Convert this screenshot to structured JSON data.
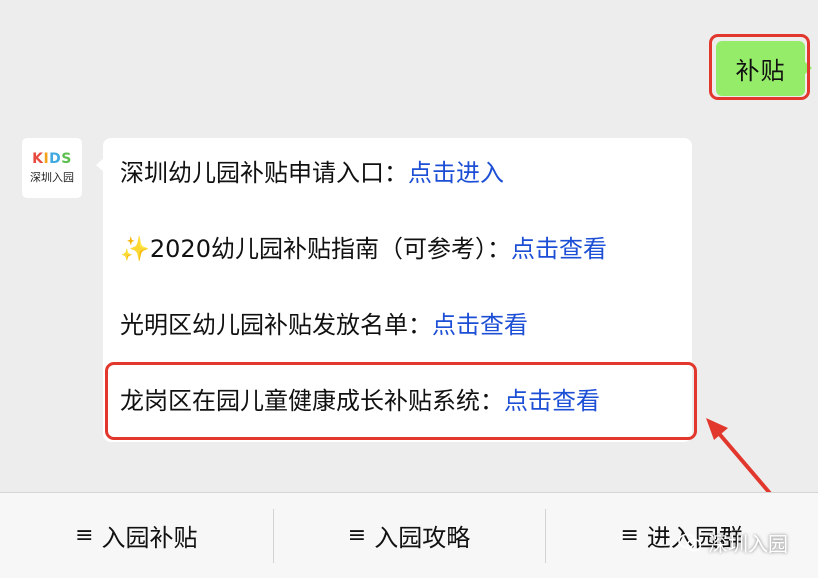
{
  "user_message": "补贴",
  "avatar": {
    "logo_letters": [
      "K",
      "I",
      "D",
      "S"
    ],
    "name": "深圳入园"
  },
  "bot_message": {
    "lines": [
      {
        "prefix": "",
        "text": "深圳幼儿园补贴申请入口：",
        "link": "点击进入"
      },
      {
        "prefix": "✨",
        "text": "2020幼儿园补贴指南（可参考）：",
        "link": "点击查看"
      },
      {
        "prefix": "",
        "text": "光明区幼儿园补贴发放名单：",
        "link": "点击查看"
      },
      {
        "prefix": "",
        "text": "龙岗区在园儿童健康成长补贴系统：",
        "link": "点击查看"
      }
    ]
  },
  "menu": {
    "icon": "≡",
    "items": [
      "入园补贴",
      "入园攻略",
      "进入园群"
    ]
  },
  "watermark": "深圳入园",
  "colors": {
    "highlight": "#e2372c",
    "link": "#1d4fd6",
    "user_bubble": "#95ec69"
  }
}
